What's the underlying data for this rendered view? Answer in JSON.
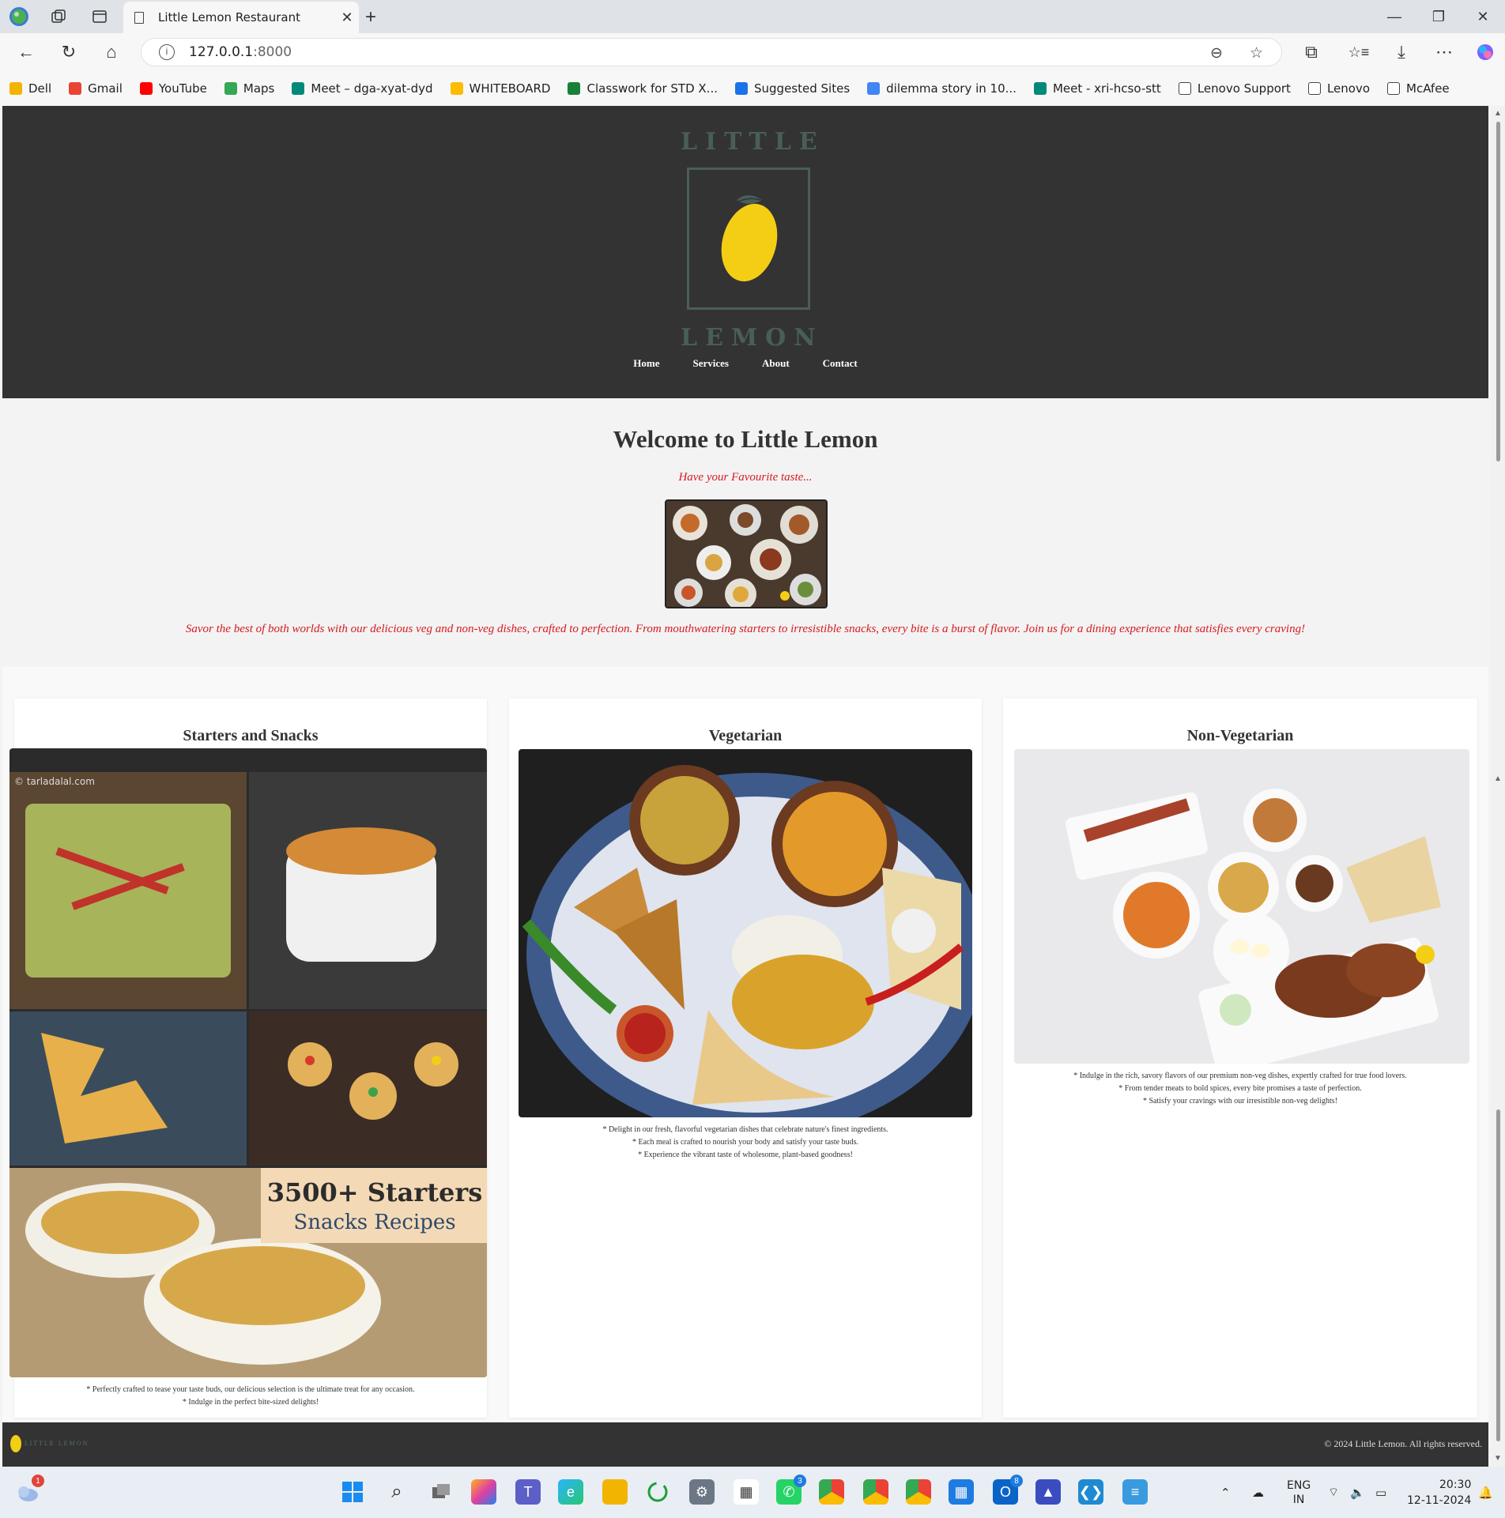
{
  "browser": {
    "tab_title": "Little Lemon Restaurant",
    "url_host": "127.0.0.1",
    "url_port": ":8000",
    "bookmarks": [
      {
        "label": "Dell",
        "color": "#f2b400"
      },
      {
        "label": "Gmail",
        "color": "#ea4335"
      },
      {
        "label": "YouTube",
        "color": "#ff0000"
      },
      {
        "label": "Maps",
        "color": "#34a853"
      },
      {
        "label": "Meet – dga-xyat-dyd",
        "color": "#00897b"
      },
      {
        "label": "WHITEBOARD",
        "color": "#fbbc04"
      },
      {
        "label": "Classwork for STD X...",
        "color": "#188038"
      },
      {
        "label": "Suggested Sites",
        "color": "#1a73e8"
      },
      {
        "label": "dilemma story in 10...",
        "color": "#4285f4"
      },
      {
        "label": "Meet - xri-hcso-stt",
        "color": "#00897b"
      },
      {
        "label": "Lenovo Support",
        "color": "#ffffff"
      },
      {
        "label": "Lenovo",
        "color": "#ffffff"
      },
      {
        "label": "McAfee",
        "color": "#ffffff"
      }
    ]
  },
  "site": {
    "logo_top": "LITTLE",
    "logo_bottom": "LEMON",
    "nav": [
      "Home",
      "Services",
      "About",
      "Contact"
    ],
    "hero": {
      "title": "Welcome to Little Lemon",
      "tagline": "Have your Favourite taste...",
      "description": "Savor the best of both worlds with our delicious veg and non-veg dishes, crafted to perfection. From mouthwatering starters to irresistible snacks, every bite is a burst of flavor. Join us for a dining experience that satisfies every craving!"
    },
    "cards": [
      {
        "title": "Starters and Snacks",
        "image_watermark": "© tarladalal.com",
        "image_text_1": "3500+ Starters",
        "image_text_2": "Snacks Recipes",
        "notes": [
          "* Perfectly crafted to tease your taste buds, our delicious selection is the ultimate treat for any occasion.",
          "* Indulge in the perfect bite-sized delights!"
        ]
      },
      {
        "title": "Vegetarian",
        "notes": [
          "* Delight in our fresh, flavorful vegetarian dishes that celebrate nature's finest ingredients.",
          "* Each meal is crafted to nourish your body and satisfy your taste buds.",
          "* Experience the vibrant taste of wholesome, plant-based goodness!"
        ]
      },
      {
        "title": "Non-Vegetarian",
        "notes": [
          "* Indulge in the rich, savory flavors of our premium non-veg dishes, expertly crafted for true food lovers.",
          "* From tender meats to bold spices, every bite promises a taste of perfection.",
          "* Satisfy your cravings with our irresistible non-veg delights!"
        ]
      }
    ],
    "footer_logo": "LITTLE LEMON",
    "footer_copy": "© 2024 Little Lemon. All rights reserved."
  },
  "taskbar": {
    "weather_badge": "1",
    "teams_badge": "3",
    "outlook_badge": "8",
    "lang_1": "ENG",
    "lang_2": "IN",
    "time": "20:30",
    "date": "12-11-2024"
  }
}
